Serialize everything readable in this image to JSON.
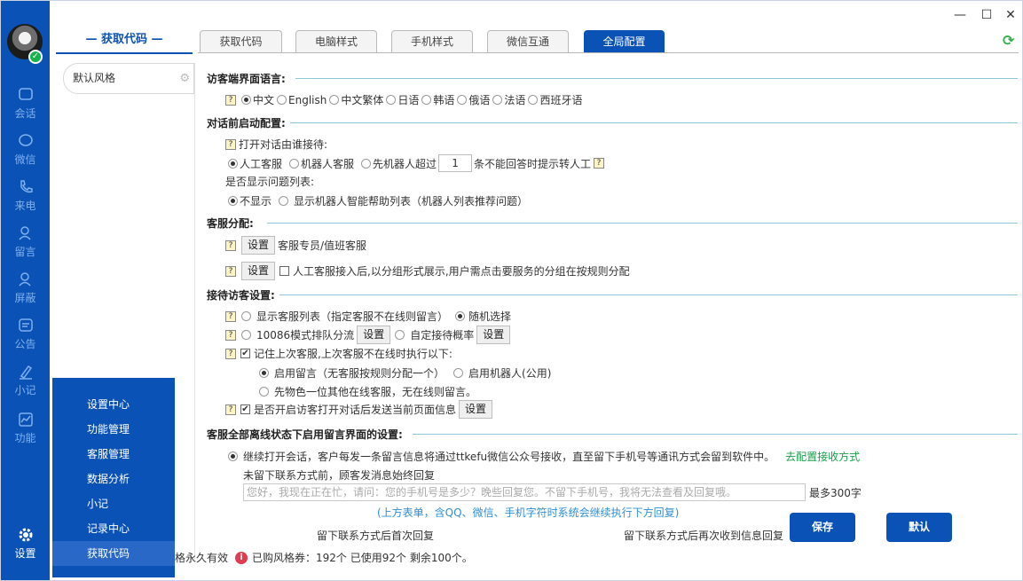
{
  "rail": {
    "items": [
      {
        "label": "会话",
        "icon": "chat-bubble-icon"
      },
      {
        "label": "微信",
        "icon": "wechat-icon"
      },
      {
        "label": "来电",
        "icon": "phone-icon"
      },
      {
        "label": "留言",
        "icon": "user-message-icon"
      },
      {
        "label": "屏蔽",
        "icon": "block-user-icon"
      },
      {
        "label": "公告",
        "icon": "announcement-icon"
      },
      {
        "label": "小记",
        "icon": "pen-icon"
      },
      {
        "label": "功能",
        "icon": "chart-icon"
      },
      {
        "label": "设置",
        "icon": "gear-icon"
      }
    ]
  },
  "window": {
    "minimize": "—",
    "maximize": "☐",
    "close": "✕"
  },
  "header": {
    "section_title": "— 获取代码 —",
    "tabs": [
      {
        "label": "获取代码",
        "active": false
      },
      {
        "label": "电脑样式",
        "active": false
      },
      {
        "label": "手机样式",
        "active": false
      },
      {
        "label": "微信互通",
        "active": false
      },
      {
        "label": "全局配置",
        "active": true
      }
    ]
  },
  "style_list": {
    "items": [
      {
        "label": "默认风格"
      }
    ]
  },
  "popup_menu": {
    "items": [
      {
        "label": "设置中心"
      },
      {
        "label": "功能管理"
      },
      {
        "label": "客服管理"
      },
      {
        "label": "数据分析"
      },
      {
        "label": "小记"
      },
      {
        "label": "记录中心"
      },
      {
        "label": "获取代码",
        "active": true
      }
    ]
  },
  "config": {
    "lang": {
      "title": "访客端界面语言:",
      "options": [
        "中文",
        "English",
        "中文繁体",
        "日语",
        "韩语",
        "俄语",
        "法语",
        "西班牙语"
      ],
      "selected": "中文"
    },
    "pre_chat": {
      "title": "对话前启动配置:",
      "who_label": "打开对话由谁接待:",
      "opt_human": "人工客服",
      "opt_robot": "机器人客服",
      "opt_robot_first": "先机器人超过",
      "threshold": "1",
      "threshold_suffix": "条不能回答时提示转人工",
      "show_q_label": "是否显示问题列表:",
      "opt_hide": "不显示",
      "opt_show": "显示机器人智能帮助列表（机器人列表推荐问题）"
    },
    "assign": {
      "title": "客服分配:",
      "btn": "设置",
      "row1_text": "客服专员/值班客服",
      "row2_text": "人工客服接入后,以分组形式展示,用户需点击要服务的分组在按规则分配"
    },
    "reception": {
      "title": "接待访客设置:",
      "show_list": "显示客服列表（指定客服不在线则留言）",
      "random": "随机选择",
      "queue": "10086模式排队分流",
      "custom_prob": "自定接待概率",
      "remember": "记住上次客服,上次客服不在线时执行以下:",
      "opt_msg": "启用留言（无客服按规则分配一个）",
      "opt_robot": "启用机器人(公用)",
      "opt_first_color": "先物色一位其他在线客服，无在线则留言。",
      "send_page": "是否开启访客打开对话后发送当前页面信息",
      "btn": "设置"
    },
    "offline": {
      "title": "客服全部离线状态下启用留言界面的设置:",
      "continue_text": "继续打开会话，客户每发一条留言信息将通过ttkefu微信公众号接收，直至留下手机号等通讯方式会留到软件中。",
      "link": "去配置接收方式",
      "before_label": "未留下联系方式前，顾客发消息始终回复",
      "reply_placeholder": "您好，我现在正在忙，请问：您的手机号是多少？晚些回复您。不留下手机号，我将无法查看及回复哦。",
      "max_len": "最多300字",
      "tip": "(上方表单，含QQ、微信、手机字符时系统会继续执行下方回复)",
      "after_first": "留下联系方式后首次回复",
      "after_again": "留下联系方式后再次收到信息回复"
    }
  },
  "actions": {
    "save": "保存",
    "default": "默认"
  },
  "footer": {
    "validity": "格永久有效",
    "coupon": "已购风格券：192个 已使用92个 剩余100个。"
  }
}
